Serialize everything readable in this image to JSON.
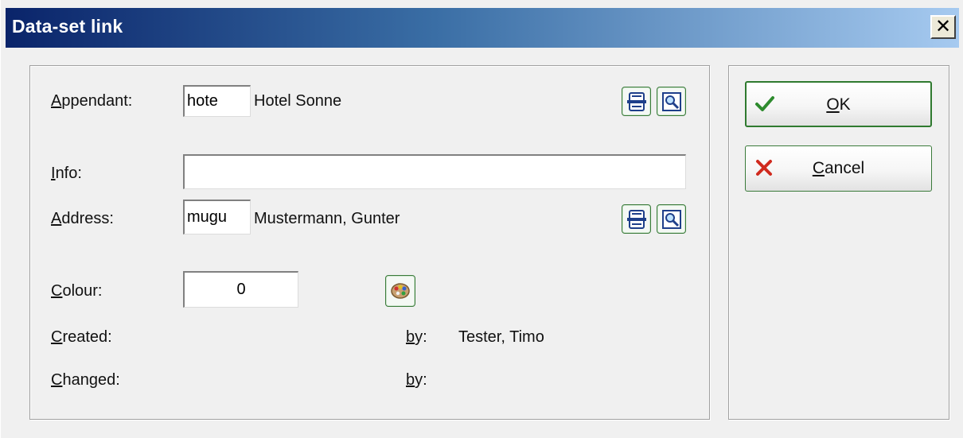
{
  "window": {
    "title": "Data-set link",
    "close_glyph": "✕"
  },
  "form": {
    "appendant": {
      "label_key": "A",
      "label_rest": "ppendant:",
      "code": "hote",
      "name": "Hotel Sonne"
    },
    "info": {
      "label_key": "I",
      "label_rest": "nfo:",
      "value": ""
    },
    "address": {
      "label_key": "A",
      "label_rest": "ddress:",
      "code": "mugu",
      "name": "Mustermann, Gunter"
    },
    "colour": {
      "label_key": "C",
      "label_rest": "olour:",
      "value": "0"
    },
    "created": {
      "label_key": "C",
      "label_rest": "reated:",
      "by_key": "b",
      "by_rest": "y:",
      "by_value": "Tester, Timo"
    },
    "changed": {
      "label_key": "C",
      "label_rest": "hanged:",
      "by_key": "b",
      "by_rest": "y:",
      "by_value": ""
    }
  },
  "buttons": {
    "ok": {
      "key": "O",
      "rest": "K"
    },
    "cancel": {
      "key": "C",
      "rest": "ancel"
    }
  },
  "icons": {
    "list": "list-icon",
    "search": "magnifier-icon",
    "palette": "palette-icon",
    "check": "check-icon",
    "cross": "cross-icon"
  },
  "colors": {
    "title_gradient_start": "#0a246a",
    "title_gradient_end": "#a6caf0",
    "button_border": "#3a7a3a",
    "check_green": "#2e8b2e",
    "cross_red": "#d02a1e"
  }
}
